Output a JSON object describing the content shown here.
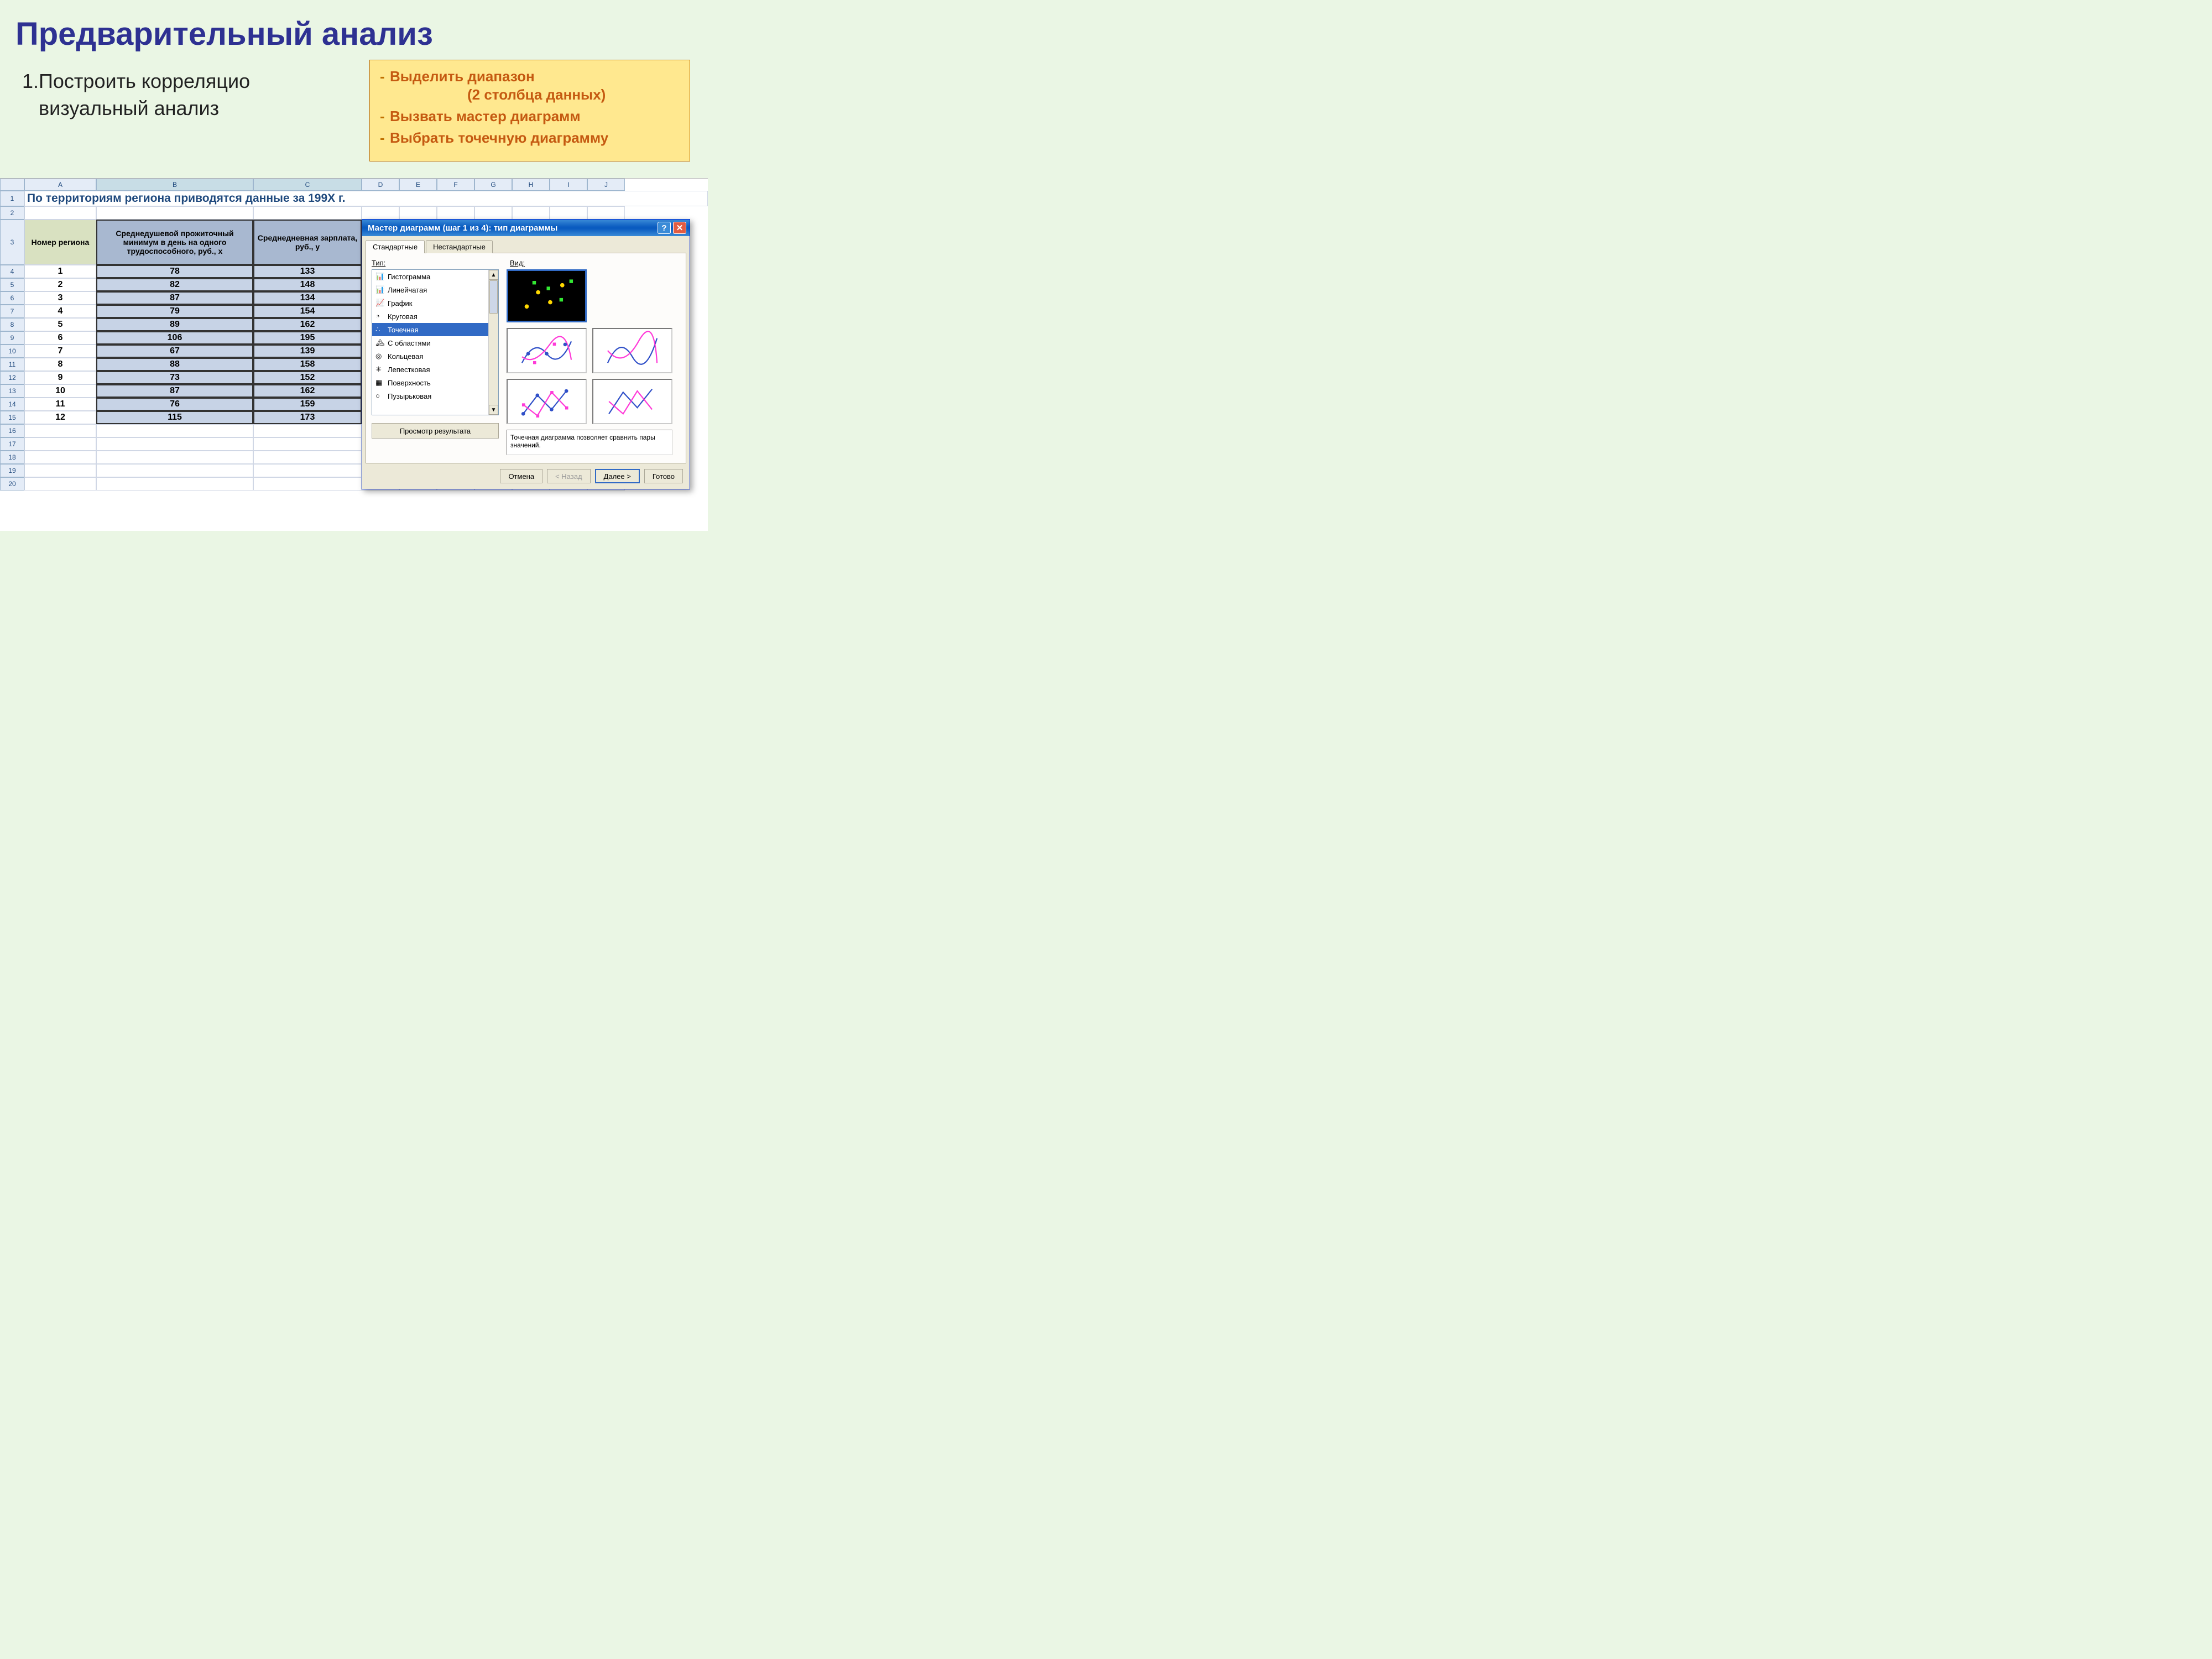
{
  "title": "Предварительный анализ",
  "step": {
    "num": "1.",
    "l1": "Построить корреляцио",
    "l2": "визуальный анализ"
  },
  "callout": {
    "i1": "Выделить диапазон",
    "i1b": "(2 столбца данных)",
    "i2": "Вызвать мастер диаграмм",
    "i3": "Выбрать точечную диаграмму"
  },
  "sheet": {
    "cols": [
      "A",
      "B",
      "C",
      "D",
      "E",
      "F",
      "G",
      "H",
      "I",
      "J"
    ],
    "row1": "По территориям региона приводятся данные за 199X г.",
    "headA": "Номер региона",
    "headB": "Среднедушевой прожиточный минимум в день на одного трудоспособного, руб., x",
    "headC": "Среднедневная зарплата, руб., y",
    "data": [
      {
        "r": 4,
        "a": "1",
        "b": "78",
        "c": "133"
      },
      {
        "r": 5,
        "a": "2",
        "b": "82",
        "c": "148"
      },
      {
        "r": 6,
        "a": "3",
        "b": "87",
        "c": "134"
      },
      {
        "r": 7,
        "a": "4",
        "b": "79",
        "c": "154"
      },
      {
        "r": 8,
        "a": "5",
        "b": "89",
        "c": "162"
      },
      {
        "r": 9,
        "a": "6",
        "b": "106",
        "c": "195"
      },
      {
        "r": 10,
        "a": "7",
        "b": "67",
        "c": "139"
      },
      {
        "r": 11,
        "a": "8",
        "b": "88",
        "c": "158"
      },
      {
        "r": 12,
        "a": "9",
        "b": "73",
        "c": "152"
      },
      {
        "r": 13,
        "a": "10",
        "b": "87",
        "c": "162"
      },
      {
        "r": 14,
        "a": "11",
        "b": "76",
        "c": "159"
      },
      {
        "r": 15,
        "a": "12",
        "b": "115",
        "c": "173"
      }
    ],
    "empty_rows": [
      16,
      17,
      18,
      19,
      20
    ]
  },
  "dialog": {
    "title": "Мастер диаграмм (шаг 1 из 4): тип диаграммы",
    "tab1": "Стандартные",
    "tab2": "Нестандартные",
    "label_type": "Тип:",
    "label_view": "Вид:",
    "types": [
      "Гистограмма",
      "Линейчатая",
      "График",
      "Круговая",
      "Точечная",
      "С областями",
      "Кольцевая",
      "Лепестковая",
      "Поверхность",
      "Пузырьковая"
    ],
    "selected_type_index": 4,
    "desc": "Точечная диаграмма позволяет сравнить пары значений.",
    "preview_btn": "Просмотр результата",
    "btn_cancel": "Отмена",
    "btn_back": "< Назад",
    "btn_next": "Далее >",
    "btn_finish": "Готово"
  }
}
